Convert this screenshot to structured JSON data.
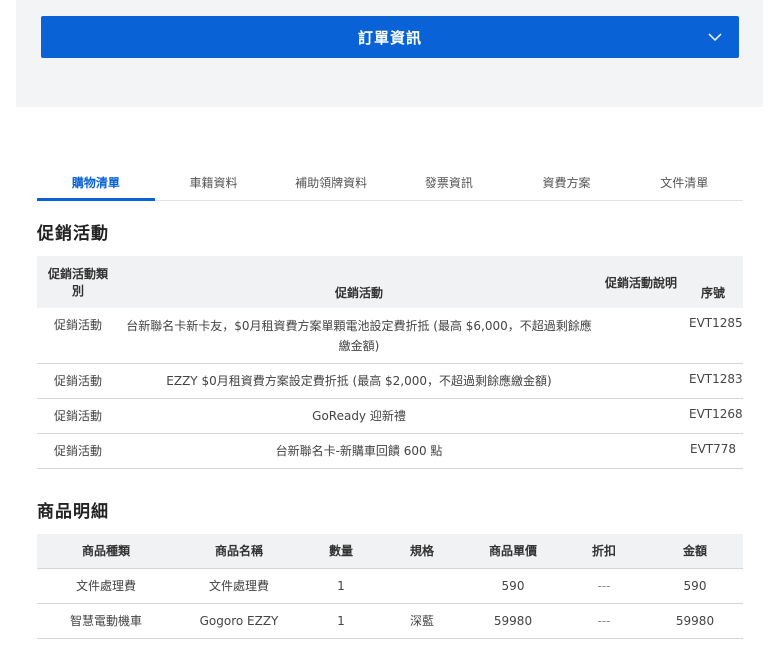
{
  "order_bar": {
    "title": "訂單資訊"
  },
  "tabs": [
    "購物清單",
    "車籍資料",
    "補助領牌資料",
    "發票資訊",
    "資費方案",
    "文件清單"
  ],
  "promotions": {
    "heading": "促銷活動",
    "headers": [
      "促銷活動類別",
      "促銷活動",
      "促銷活動說明",
      "序號"
    ],
    "rows": [
      {
        "category": "促銷活動",
        "activity": "台新聯名卡新卡友，$0月租資費方案單顆電池設定費折抵 (最高 $6,000，不超過剩餘應繳金額)",
        "desc": "",
        "serial": "EVT1285"
      },
      {
        "category": "促銷活動",
        "activity": "EZZY $0月租資費方案設定費折抵 (最高 $2,000，不超過剩餘應繳金額)",
        "desc": "",
        "serial": "EVT1283"
      },
      {
        "category": "促銷活動",
        "activity": "GoReady 迎新禮",
        "desc": "",
        "serial": "EVT1268"
      },
      {
        "category": "促銷活動",
        "activity": "台新聯名卡-新購車回饋 600 點",
        "desc": "",
        "serial": "EVT778"
      }
    ]
  },
  "products": {
    "heading": "商品明細",
    "headers": [
      "商品種類",
      "商品名稱",
      "數量",
      "規格",
      "商品單價",
      "折扣",
      "金額"
    ],
    "rows": [
      {
        "type": "文件處理費",
        "name": "文件處理費",
        "qty": "1",
        "spec": "",
        "price": "590",
        "discount": "---",
        "amount": "590"
      },
      {
        "type": "智慧電動機車",
        "name": "Gogoro EZZY",
        "qty": "1",
        "spec": "深藍",
        "price": "59980",
        "discount": "---",
        "amount": "59980"
      }
    ]
  }
}
